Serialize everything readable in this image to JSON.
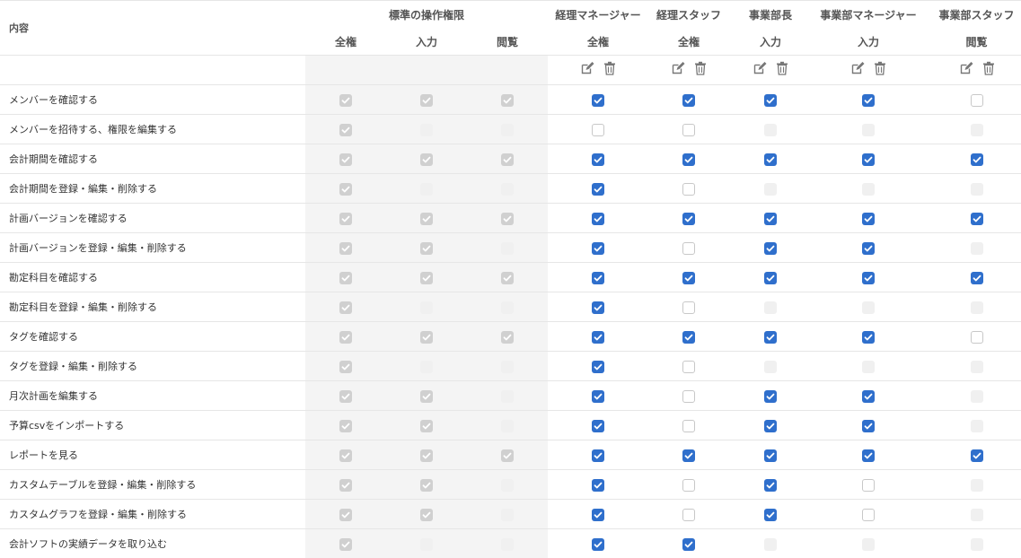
{
  "header": {
    "content_label": "内容",
    "standard_group": "標準の操作権限",
    "standard_cols": [
      "全権",
      "入力",
      "閲覧"
    ],
    "roles": [
      {
        "name": "経理マネージャー",
        "level": "全権"
      },
      {
        "name": "経理スタッフ",
        "level": "全権"
      },
      {
        "name": "事業部長",
        "level": "入力"
      },
      {
        "name": "事業部マネージャー",
        "level": "入力"
      },
      {
        "name": "事業部スタッフ",
        "level": "閲覧"
      }
    ]
  },
  "icons": {
    "edit": "edit-icon",
    "delete": "trash-icon"
  },
  "colors": {
    "checked": "#2f6fcc",
    "disabled_checked": "#d0d0d0",
    "disabled_unchecked": "#f0f0f0",
    "standard_bg": "#f4f4f4"
  },
  "rows": [
    {
      "label": "メンバーを確認する",
      "std": [
        "c",
        "c",
        "c"
      ],
      "roles": [
        "c",
        "c",
        "c",
        "c",
        "u"
      ]
    },
    {
      "label": "メンバーを招待する、権限を編集する",
      "std": [
        "c",
        "d",
        "d"
      ],
      "roles": [
        "u",
        "u",
        "d",
        "d",
        "d"
      ]
    },
    {
      "label": "会計期間を確認する",
      "std": [
        "c",
        "c",
        "c"
      ],
      "roles": [
        "c",
        "c",
        "c",
        "c",
        "c"
      ]
    },
    {
      "label": "会計期間を登録・編集・削除する",
      "std": [
        "c",
        "d",
        "d"
      ],
      "roles": [
        "c",
        "u",
        "d",
        "d",
        "d"
      ]
    },
    {
      "label": "計画バージョンを確認する",
      "std": [
        "c",
        "c",
        "c"
      ],
      "roles": [
        "c",
        "c",
        "c",
        "c",
        "c"
      ]
    },
    {
      "label": "計画バージョンを登録・編集・削除する",
      "std": [
        "c",
        "c",
        "d"
      ],
      "roles": [
        "c",
        "u",
        "c",
        "c",
        "d"
      ]
    },
    {
      "label": "勘定科目を確認する",
      "std": [
        "c",
        "c",
        "c"
      ],
      "roles": [
        "c",
        "c",
        "c",
        "c",
        "c"
      ]
    },
    {
      "label": "勘定科目を登録・編集・削除する",
      "std": [
        "c",
        "d",
        "d"
      ],
      "roles": [
        "c",
        "u",
        "d",
        "d",
        "d"
      ]
    },
    {
      "label": "タグを確認する",
      "std": [
        "c",
        "c",
        "c"
      ],
      "roles": [
        "c",
        "c",
        "c",
        "c",
        "u"
      ]
    },
    {
      "label": "タグを登録・編集・削除する",
      "std": [
        "c",
        "d",
        "d"
      ],
      "roles": [
        "c",
        "u",
        "d",
        "d",
        "d"
      ]
    },
    {
      "label": "月次計画を編集する",
      "std": [
        "c",
        "c",
        "d"
      ],
      "roles": [
        "c",
        "u",
        "c",
        "c",
        "d"
      ]
    },
    {
      "label": "予算csvをインポートする",
      "std": [
        "c",
        "c",
        "d"
      ],
      "roles": [
        "c",
        "u",
        "c",
        "c",
        "d"
      ]
    },
    {
      "label": "レポートを見る",
      "std": [
        "c",
        "c",
        "c"
      ],
      "roles": [
        "c",
        "c",
        "c",
        "c",
        "c"
      ]
    },
    {
      "label": "カスタムテーブルを登録・編集・削除する",
      "std": [
        "c",
        "c",
        "d"
      ],
      "roles": [
        "c",
        "u",
        "c",
        "u",
        "d"
      ]
    },
    {
      "label": "カスタムグラフを登録・編集・削除する",
      "std": [
        "c",
        "c",
        "d"
      ],
      "roles": [
        "c",
        "u",
        "c",
        "u",
        "d"
      ]
    },
    {
      "label": "会計ソフトの実績データを取り込む",
      "std": [
        "c",
        "d",
        "d"
      ],
      "roles": [
        "c",
        "c",
        "d",
        "d",
        "d"
      ]
    }
  ]
}
